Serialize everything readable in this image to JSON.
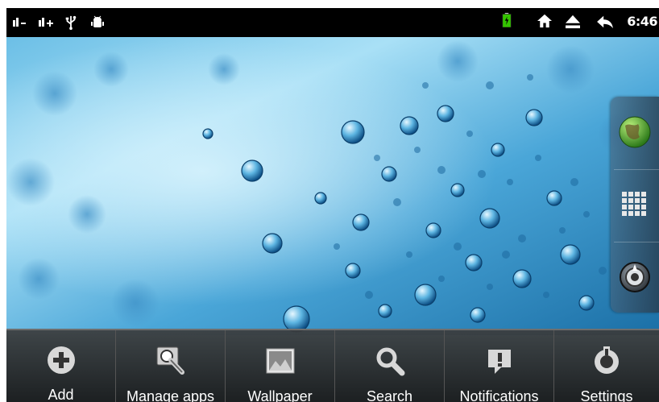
{
  "status_bar": {
    "time": "6:46",
    "icons": [
      "signal-icon",
      "signal-plus-icon",
      "usb-icon",
      "android-debug-icon",
      "battery-charging-icon",
      "home-icon",
      "eject-icon",
      "back-icon"
    ]
  },
  "dock": {
    "items": [
      "browser-globe-icon",
      "app-grid-icon",
      "compass-icon"
    ]
  },
  "menu": {
    "items": [
      {
        "label": "Add",
        "icon": "add-icon"
      },
      {
        "label": "Manage apps",
        "icon": "manage-apps-icon"
      },
      {
        "label": "Wallpaper",
        "icon": "wallpaper-icon"
      },
      {
        "label": "Search",
        "icon": "search-icon"
      },
      {
        "label": "Notifications",
        "icon": "notifications-icon"
      },
      {
        "label": "Settings",
        "icon": "settings-icon"
      }
    ]
  },
  "colors": {
    "wallpaper_light": "#9ed8f2",
    "wallpaper_dark": "#1f7fb8",
    "battery_green": "#34c400",
    "menu_bg": "#2a2a2a"
  }
}
